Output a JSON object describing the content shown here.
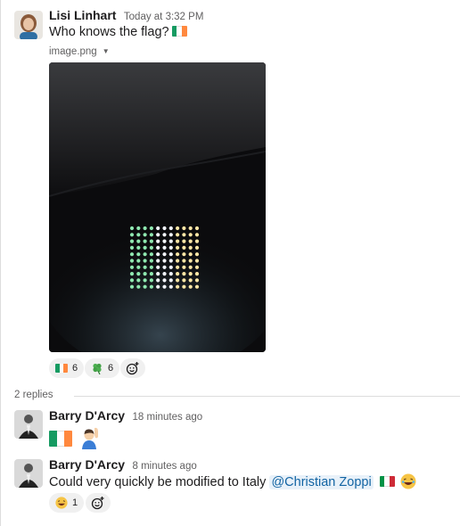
{
  "parent": {
    "author": "Lisi Linhart",
    "timestamp": "Today at 3:32 PM",
    "text": "Who knows the flag?",
    "flag": "ireland-flag",
    "attachment": {
      "filename": "image.png"
    },
    "reactions": [
      {
        "emoji": "ireland-flag",
        "count": "6"
      },
      {
        "emoji": "four-leaf-clover",
        "count": "6"
      }
    ]
  },
  "thread": {
    "replies_label": "2 replies"
  },
  "replies": [
    {
      "author": "Barry D'Arcy",
      "timestamp": "18 minutes ago",
      "emoji": [
        "ireland-flag",
        "raising-hand-person"
      ]
    },
    {
      "author": "Barry D'Arcy",
      "timestamp": "8 minutes ago",
      "text": "Could very quickly be modified to Italy",
      "mention": "@Christian Zoppi",
      "emoji": [
        "italy-flag",
        "laughing-face"
      ],
      "reactions": [
        {
          "emoji": "laughing-face",
          "count": "1"
        }
      ]
    }
  ],
  "colors": {
    "ireland": [
      "#169b62",
      "#ffffff",
      "#ff883e"
    ],
    "italy": [
      "#009246",
      "#ffffff",
      "#ce2b37"
    ],
    "mention_bg": "#e8f1f9",
    "mention_text": "#1264a3"
  }
}
